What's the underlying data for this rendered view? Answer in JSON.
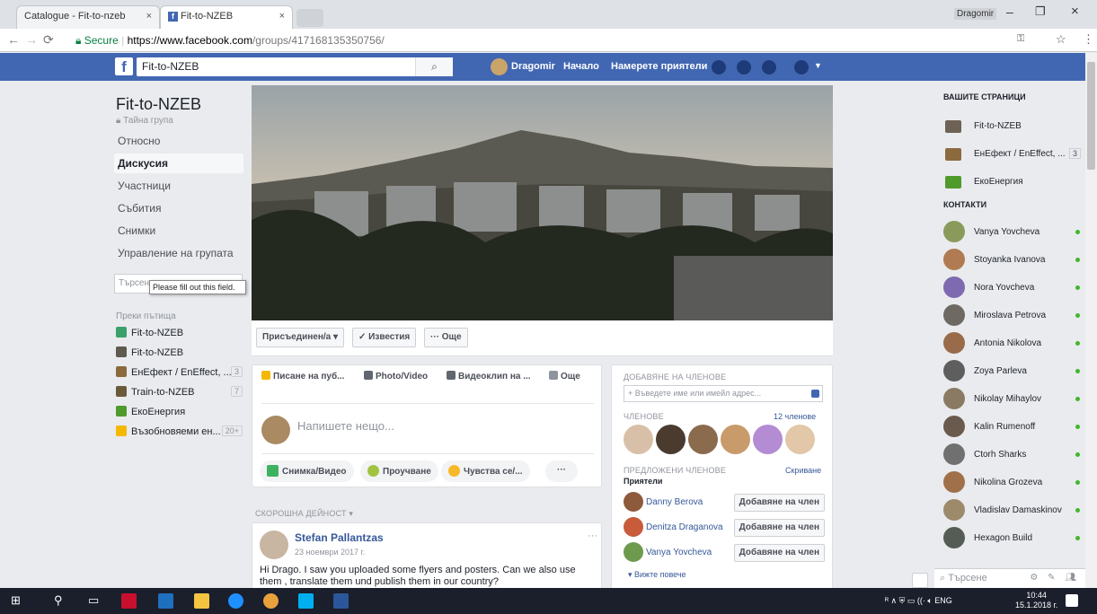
{
  "browser": {
    "tabs": [
      {
        "label": "Catalogue - Fit-to-nzeb"
      },
      {
        "label": "Fit-to-NZEB"
      }
    ],
    "user": "Dragomir",
    "url": {
      "secure_label": "Secure",
      "host": "https://www.facebook.com",
      "path": "/groups/417168135350756/"
    }
  },
  "topbar": {
    "search_value": "Fit-to-NZEB",
    "user": "Dragomir",
    "home": "Начало",
    "find_friends": "Намерете приятели"
  },
  "group": {
    "name": "Fit-to-NZEB",
    "privacy": "Тайна група",
    "nav": [
      "Относно",
      "Дискусия",
      "Участници",
      "Събития",
      "Снимки",
      "Управление на групата"
    ],
    "selected_nav": "Дискусия",
    "search_placeholder": "Търсене",
    "validation_tooltip": "Please fill out this field.",
    "shortcuts_header": "Преки пътища",
    "shortcuts": [
      {
        "label": "Fit-to-NZEB",
        "count": "",
        "color": "#3aa16a"
      },
      {
        "label": "Fit-to-NZEB",
        "count": "",
        "color": "#5f5a50"
      },
      {
        "label": "ЕнЕфект / EnEffect, ...",
        "count": "3",
        "color": "#8b6a3e"
      },
      {
        "label": "Train-to-NZEB",
        "count": "7",
        "color": "#6b5a3a"
      },
      {
        "label": "ЕкоЕнергия",
        "count": "",
        "color": "#4e9a2a"
      },
      {
        "label": "Възобновяеми ен...",
        "count": "20+",
        "color": "#f5b800"
      }
    ]
  },
  "cover_actions": {
    "joined": "Присъединен/а ▾",
    "notifications": "✓ Известия",
    "more": "··· Още"
  },
  "composer": {
    "tabs": [
      "Писане на пуб...",
      "Photo/Video",
      "Видеоклип на ...",
      "Още"
    ],
    "placeholder": "Напишете нещо...",
    "pills": [
      "Снимка/Видео",
      "Проучване",
      "Чувства се/...",
      "···"
    ]
  },
  "feed": {
    "recent_label": "СКОРОШНА ДЕЙНОСТ ▾",
    "post": {
      "author": "Stefan Pallantzas",
      "date": "23 ноември 2017 г.",
      "more": "···",
      "text": "Hi Drago. I saw you uploaded some flyers and posters. Can we also use them , translate them und publish them in our country?"
    }
  },
  "members": {
    "add_header": "ДОБАВЯНЕ НА ЧЛЕНОВЕ",
    "add_placeholder": "+ Въведете име или имейл адрес...",
    "members_header": "ЧЛЕНОВЕ",
    "members_count": "12 членове",
    "suggested_header": "ПРЕДЛОЖЕНИ ЧЛЕНОВЕ",
    "hide": "Скриване",
    "friends_label": "Приятели",
    "suggested": [
      {
        "name": "Danny Berova"
      },
      {
        "name": "Denitza Draganova"
      },
      {
        "name": "Vanya Yovcheva"
      }
    ],
    "add_button": "Добавяне на член",
    "see_more": "▾ Вижте повече"
  },
  "rightbar": {
    "pages_header": "ВАШИТЕ СТРАНИЦИ",
    "pages": [
      {
        "name": "Fit-to-NZEB",
        "badge": ""
      },
      {
        "name": "ЕнЕфект / EnEffect, ...",
        "badge": "3"
      },
      {
        "name": "ЕкоЕнергия",
        "badge": ""
      }
    ],
    "contacts_header": "КОНТАКТИ",
    "contacts": [
      "Vanya Yovcheva",
      "Stoyanka Ivanova",
      "Nora Yovcheva",
      "Miroslava Petrova",
      "Antonia Nikolova",
      "Zoya Parleva",
      "Nikolay Mihaylov",
      "Kalin Rumenoff",
      "Ctorh Sharks",
      "Nikolina Grozeva",
      "Vladislav Damaskinov",
      "Hexagon Build"
    ],
    "chat_search_placeholder": "Търсене"
  },
  "taskbar": {
    "language": "ENG",
    "time": "10:44",
    "date": "15.1.2018 г."
  }
}
